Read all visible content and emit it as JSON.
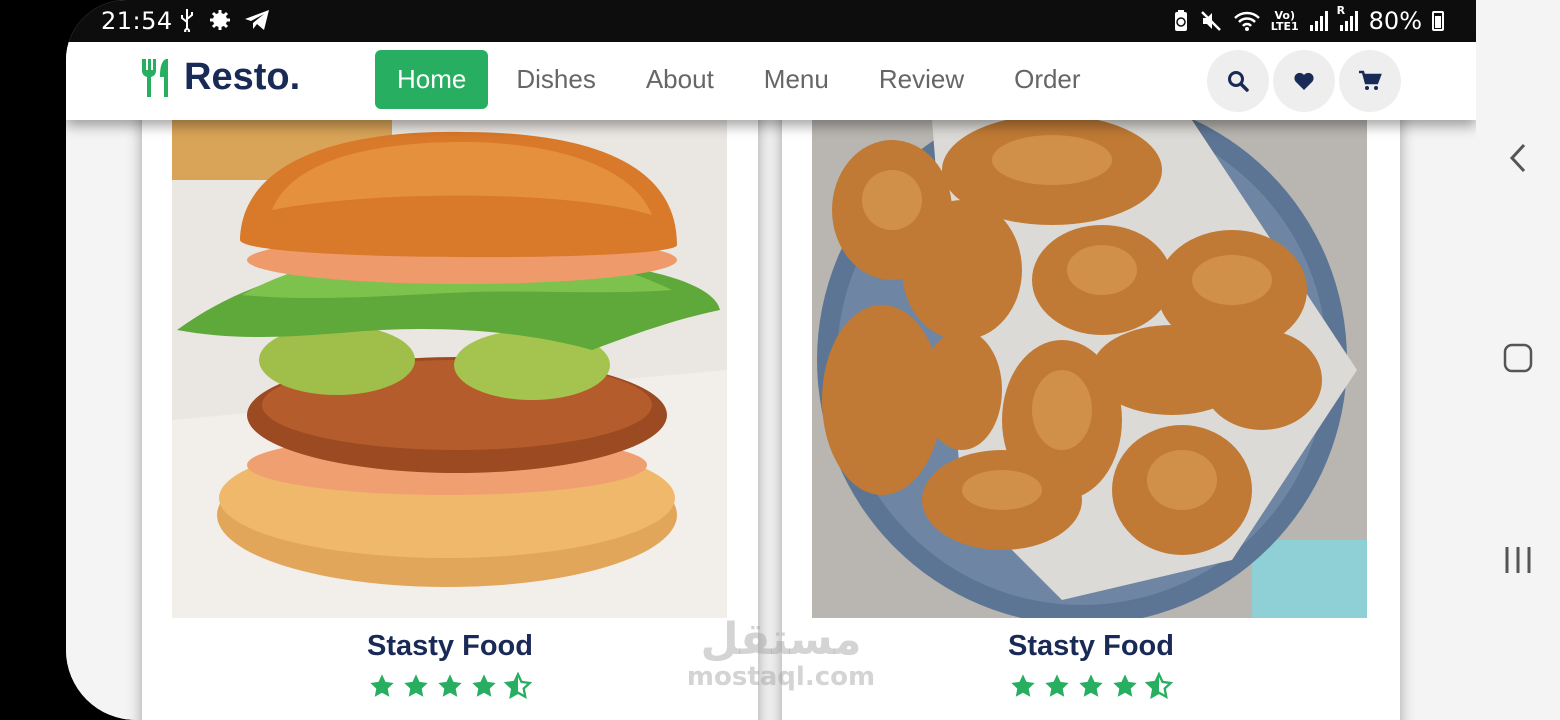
{
  "status_bar": {
    "time": "21:54",
    "battery_percent": "80%",
    "left_icons": [
      "usb-icon",
      "gear-icon",
      "telegram-icon"
    ],
    "right_icons": [
      "battery-saver-icon",
      "mute-icon",
      "wifi-icon",
      "volte-icon",
      "signal-icon",
      "roaming-signal-icon",
      "battery-icon"
    ],
    "volte_label": "Vo)\nLTE1",
    "roaming_label": "R"
  },
  "header": {
    "logo_text": "Resto.",
    "logo_icon": "utensils-icon",
    "nav": [
      {
        "label": "Home",
        "active": true
      },
      {
        "label": "Dishes",
        "active": false
      },
      {
        "label": "About",
        "active": false
      },
      {
        "label": "Menu",
        "active": false
      },
      {
        "label": "Review",
        "active": false
      },
      {
        "label": "Order",
        "active": false
      }
    ],
    "icons": [
      "search-icon",
      "heart-icon",
      "cart-icon"
    ]
  },
  "dishes": [
    {
      "name": "Stasty Food",
      "rating": 4.5,
      "image": "burger"
    },
    {
      "name": "Stasty Food",
      "rating": 4.5,
      "image": "fried-chicken"
    }
  ],
  "watermark": {
    "arabic": "مستقل",
    "latin": "mostaql.com"
  },
  "colors": {
    "accent": "#27ae60",
    "title": "#192a56",
    "nav_text": "#666666"
  },
  "android_nav": [
    "back-icon",
    "home-icon",
    "recents-icon"
  ]
}
